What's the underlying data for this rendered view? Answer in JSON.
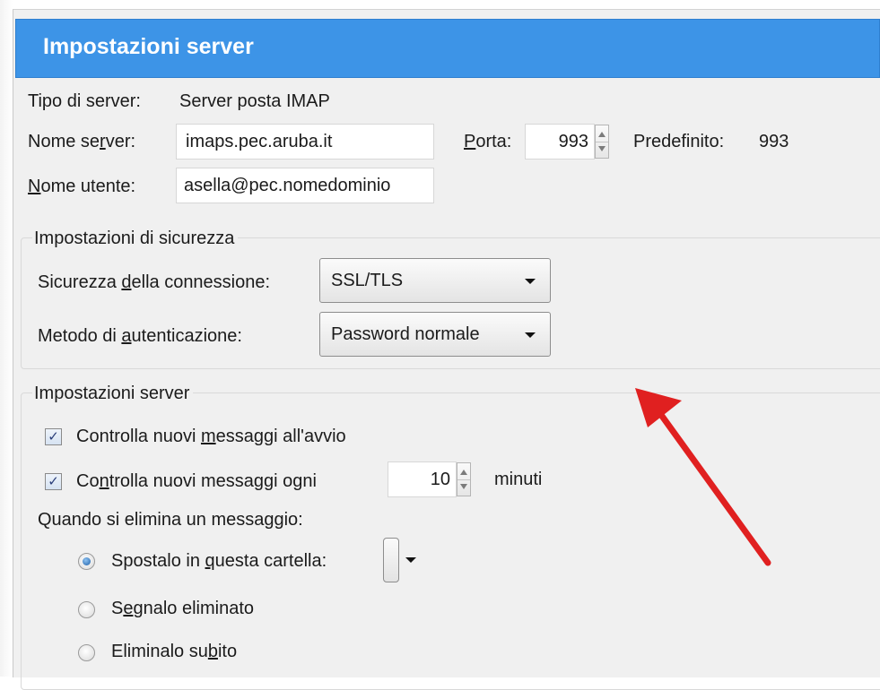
{
  "header": {
    "title": "Impostazioni server"
  },
  "server": {
    "type_label": "Tipo di server:",
    "type_value": "Server posta IMAP",
    "name_label_pre": "Nome se",
    "name_label_key": "r",
    "name_label_post": "ver:",
    "name_value": "imaps.pec.aruba.it",
    "port_label_key": "P",
    "port_label_post": "orta:",
    "port_value": "993",
    "default_label": "Predefinito:",
    "default_value": "993",
    "user_label_key": "N",
    "user_label_post": "ome utente:",
    "user_value": "asella@pec.nomedominio"
  },
  "security": {
    "legend": "Impostazioni di sicurezza",
    "connection_label_pre": "Sicurezza ",
    "connection_label_key": "d",
    "connection_label_post": "ella connessione:",
    "connection_value": "SSL/TLS",
    "auth_label_pre": "Metodo di ",
    "auth_label_key": "a",
    "auth_label_post": "utenticazione:",
    "auth_value": "Password normale"
  },
  "server_settings": {
    "legend": "Impostazioni server",
    "check_startup_pre": "Controlla nuovi ",
    "check_startup_key": "m",
    "check_startup_post": "essaggi all'avvio",
    "check_startup_checked": true,
    "check_every_pre": "Co",
    "check_every_key": "n",
    "check_every_post": "trolla nuovi messaggi ogni",
    "check_every_checked": true,
    "check_every_value": "10",
    "minutes_label": "minuti",
    "delete_label": "Quando si elimina un messaggio:",
    "radio_move_pre": "Spostalo in ",
    "radio_move_key": "q",
    "radio_move_post": "uesta cartella:",
    "radio_mark_pre": "S",
    "radio_mark_key": "e",
    "radio_mark_post": "gnalo eliminato",
    "radio_delete_pre": "Eliminalo su",
    "radio_delete_key": "b",
    "radio_delete_post": "ito",
    "selected_radio": "move"
  },
  "colors": {
    "header_bg": "#3d94e7",
    "annotation_arrow": "#e02020"
  },
  "icons": {
    "checkmark": "check-icon",
    "dropdown": "chevron-down-icon",
    "spinner": "spin-arrows-icon",
    "annotation": "red-arrow-icon"
  }
}
